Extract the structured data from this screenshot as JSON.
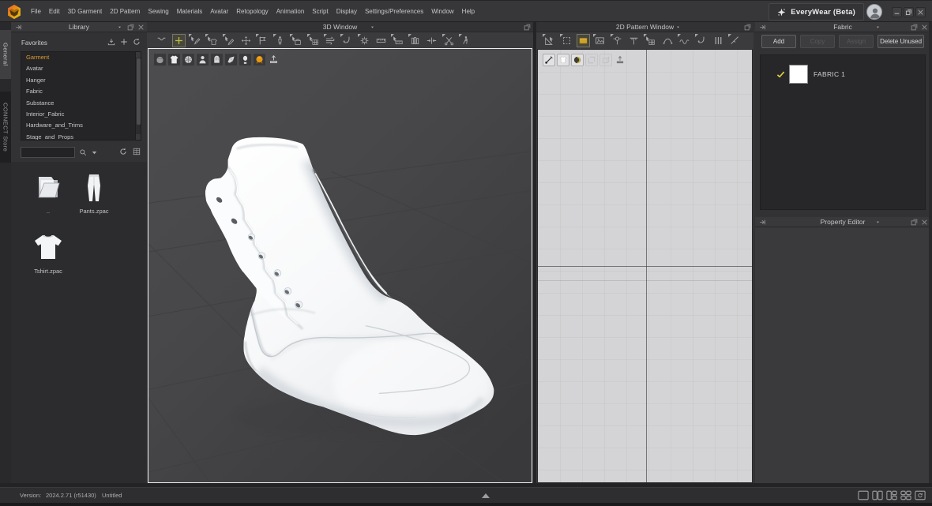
{
  "menu_bar": {
    "items": [
      "File",
      "Edit",
      "3D Garment",
      "2D Pattern",
      "Sewing",
      "Materials",
      "Avatar",
      "Retopology",
      "Animation",
      "Script",
      "Display",
      "Settings/Preferences",
      "Window",
      "Help"
    ],
    "brand_label": "EveryWear (Beta)",
    "window_controls": [
      {
        "icon": "minimize"
      },
      {
        "icon": "restore"
      },
      {
        "icon": "close"
      }
    ]
  },
  "left_rail": {
    "tabs": [
      {
        "label": "General",
        "active": true
      },
      {
        "label": "CONNECT Store",
        "active": false
      }
    ]
  },
  "library": {
    "title": "Library",
    "section_label": "Favorites",
    "section_icons": [
      {
        "icon": "import"
      },
      {
        "icon": "add"
      },
      {
        "icon": "refresh"
      }
    ],
    "favorites": [
      {
        "label": "Garment",
        "selected": true
      },
      {
        "label": "Avatar"
      },
      {
        "label": "Hanger"
      },
      {
        "label": "Fabric"
      },
      {
        "label": "Substance"
      },
      {
        "label": "Interior_Fabric"
      },
      {
        "label": "Hardware_and_Trims"
      },
      {
        "label": "Stage_and_Props"
      }
    ],
    "search": {
      "value": "",
      "placeholder": ""
    },
    "files": [
      {
        "label": "..",
        "type": "folder"
      },
      {
        "label": "Pants.zpac",
        "type": "pants"
      },
      {
        "label": "Tshirt.zpac",
        "type": "tshirt"
      }
    ]
  },
  "window_3d": {
    "title": "3D Window",
    "toolbar": [
      {
        "icon": "vneck"
      },
      {
        "icon": "plus",
        "selected": true
      },
      {
        "icon": "pen-arrow",
        "corner": true
      },
      {
        "icon": "shirt-arrow",
        "corner": true
      },
      {
        "icon": "pen2",
        "corner": true
      },
      {
        "icon": "move4"
      },
      {
        "icon": "flag",
        "corner": true
      },
      {
        "icon": "mannequin",
        "corner": true
      },
      {
        "icon": "box-arrow",
        "corner": true
      },
      {
        "icon": "grid-arrow",
        "corner": true
      },
      {
        "icon": "wind",
        "corner": true
      },
      {
        "icon": "hook",
        "corner": true
      },
      {
        "icon": "gear",
        "corner": true
      },
      {
        "icon": "tape"
      },
      {
        "icon": "tape-arrow",
        "corner": true
      },
      {
        "icon": "bars",
        "corner": true
      },
      {
        "icon": "inout"
      },
      {
        "icon": "scissors",
        "corner": true
      },
      {
        "icon": "walk",
        "corner": true
      }
    ],
    "overlay_toolbar": [
      {
        "icon": "drape"
      },
      {
        "icon": "shirt-bright"
      },
      {
        "icon": "sphere"
      },
      {
        "icon": "bust"
      },
      {
        "icon": "glove"
      },
      {
        "icon": "glove2"
      },
      {
        "icon": "head"
      },
      {
        "icon": "spotlight-orange"
      },
      {
        "icon": "platform"
      }
    ]
  },
  "window_2d": {
    "title": "2D Pattern Window",
    "toolbar": [
      {
        "icon": "tri-arrow",
        "corner": true
      },
      {
        "icon": "dot-select",
        "corner": true
      },
      {
        "icon": "rect-orange",
        "selected": true
      },
      {
        "icon": "image",
        "corner": true
      },
      {
        "icon": "pin",
        "corner": true
      },
      {
        "icon": "grid-t"
      },
      {
        "icon": "grid-arrow",
        "corner": true
      },
      {
        "icon": "curve"
      },
      {
        "icon": "flounce",
        "corner": true
      },
      {
        "icon": "hook",
        "corner": true
      },
      {
        "icon": "pleats"
      },
      {
        "icon": "notch",
        "corner": true
      }
    ],
    "overlay_toolbar": [
      {
        "icon": "needle",
        "style": "box"
      },
      {
        "icon": "shirt-outline",
        "style": "box"
      },
      {
        "icon": "circle-yellow",
        "style": "box"
      },
      {
        "icon": "square-faded",
        "style": "faded"
      },
      {
        "icon": "texture-faded",
        "style": "faded"
      },
      {
        "icon": "platform-dark",
        "style": "flat"
      }
    ]
  },
  "fabric_panel": {
    "title": "Fabric",
    "buttons": [
      {
        "label": "Add",
        "enabled": true
      },
      {
        "label": "Copy",
        "enabled": false
      },
      {
        "label": "Assign",
        "enabled": false
      },
      {
        "label": "Delete Unused",
        "enabled": true
      }
    ],
    "items": [
      {
        "label": "FABRIC 1",
        "checked": true,
        "swatch": "#ffffff"
      }
    ]
  },
  "property_panel": {
    "title": "Property Editor"
  },
  "status_bar": {
    "version_label": "Version:",
    "version": "2024.2.71 (r51430)",
    "document": "Untitled",
    "layout_icons": [
      {
        "icon": "layout-single"
      },
      {
        "icon": "layout-two"
      },
      {
        "icon": "layout-mixed"
      },
      {
        "icon": "layout-four"
      },
      {
        "icon": "layout-reset"
      }
    ]
  },
  "colors": {
    "accent_orange": "#dd9c33",
    "tool_selected_yellow": "#d2d24a",
    "fabric_check_yellow": "#e3cf3f",
    "swatch_white": "#ffffff",
    "pattern_selected_orange": "#e8b428"
  }
}
